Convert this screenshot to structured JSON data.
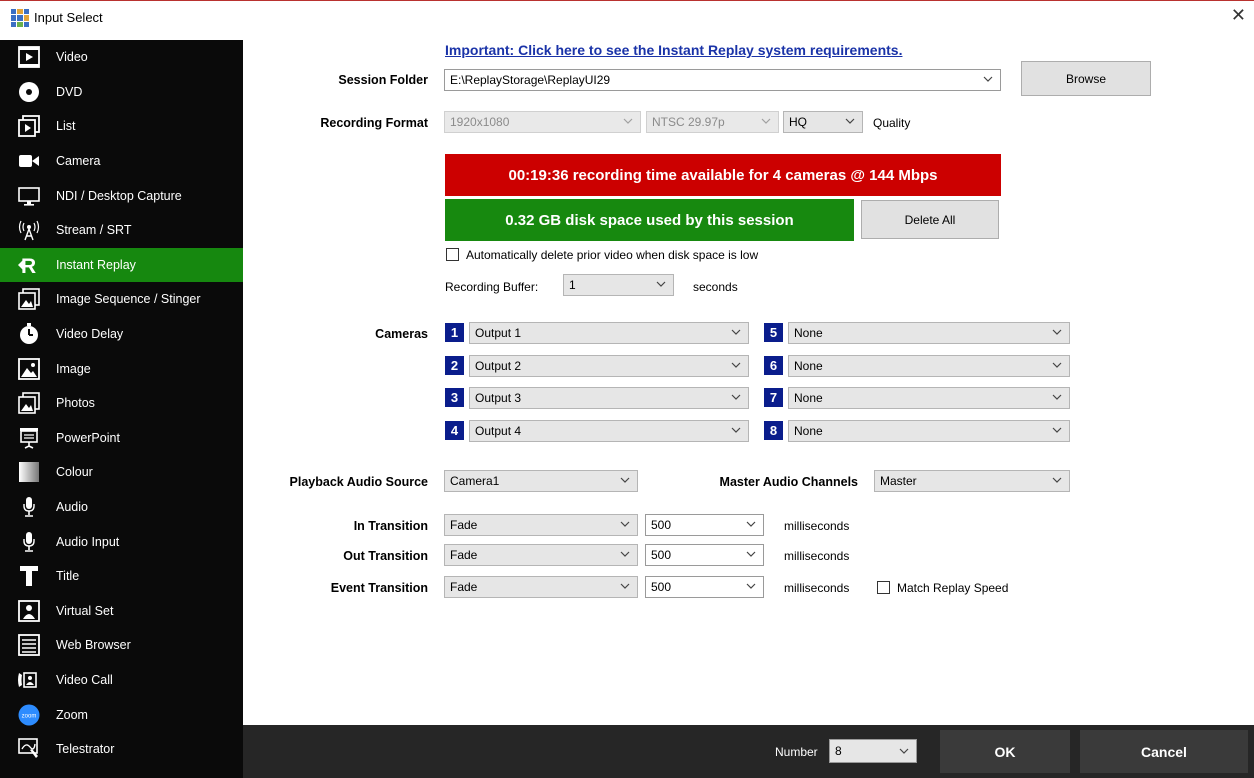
{
  "window": {
    "title": "Input Select",
    "close": "✕"
  },
  "sidebar": {
    "items": [
      {
        "label": "Video",
        "icon": "video-icon"
      },
      {
        "label": "DVD",
        "icon": "dvd-icon"
      },
      {
        "label": "List",
        "icon": "list-icon"
      },
      {
        "label": "Camera",
        "icon": "camera-icon"
      },
      {
        "label": "NDI / Desktop Capture",
        "icon": "monitor-icon"
      },
      {
        "label": "Stream / SRT",
        "icon": "antenna-icon"
      },
      {
        "label": "Instant Replay",
        "icon": "replay-icon",
        "active": true
      },
      {
        "label": "Image Sequence / Stinger",
        "icon": "image-sequence-icon"
      },
      {
        "label": "Video Delay",
        "icon": "timer-icon"
      },
      {
        "label": "Image",
        "icon": "image-icon"
      },
      {
        "label": "Photos",
        "icon": "photos-icon"
      },
      {
        "label": "PowerPoint",
        "icon": "presentation-icon"
      },
      {
        "label": "Colour",
        "icon": "colour-icon"
      },
      {
        "label": "Audio",
        "icon": "microphone-icon"
      },
      {
        "label": "Audio Input",
        "icon": "audio-input-icon"
      },
      {
        "label": "Title",
        "icon": "title-icon"
      },
      {
        "label": "Virtual Set",
        "icon": "virtual-set-icon"
      },
      {
        "label": "Web Browser",
        "icon": "web-browser-icon"
      },
      {
        "label": "Video Call",
        "icon": "video-call-icon"
      },
      {
        "label": "Zoom",
        "icon": "zoom-icon"
      },
      {
        "label": "Telestrator",
        "icon": "telestrator-icon"
      }
    ],
    "active_color": "#16880f"
  },
  "main": {
    "requirements_link": "Important: Click here to see the Instant Replay system requirements.",
    "session_folder": {
      "label": "Session Folder",
      "value": "E:\\ReplayStorage\\ReplayUI29",
      "browse": "Browse"
    },
    "recording_format": {
      "label": "Recording Format",
      "resolution": "1920x1080",
      "framerate": "NTSC 29.97p",
      "quality": "HQ",
      "quality_label": "Quality"
    },
    "recording_time_banner": "00:19:36 recording time available for 4 cameras @ 144 Mbps",
    "disk_space_banner": "0.32 GB disk space used by this session",
    "delete_all": "Delete All",
    "auto_delete_label": "Automatically delete prior video when disk space is low",
    "recording_buffer": {
      "label": "Recording Buffer:",
      "value": "1",
      "unit": "seconds"
    },
    "cameras": {
      "label": "Cameras",
      "slots": [
        {
          "num": "1",
          "value": "Output 1"
        },
        {
          "num": "2",
          "value": "Output 2"
        },
        {
          "num": "3",
          "value": "Output 3"
        },
        {
          "num": "4",
          "value": "Output 4"
        },
        {
          "num": "5",
          "value": "None"
        },
        {
          "num": "6",
          "value": "None"
        },
        {
          "num": "7",
          "value": "None"
        },
        {
          "num": "8",
          "value": "None"
        }
      ]
    },
    "playback_audio": {
      "label": "Playback Audio Source",
      "value": "Camera1"
    },
    "master_audio": {
      "label": "Master Audio Channels",
      "value": "Master"
    },
    "in_transition": {
      "label": "In Transition",
      "effect": "Fade",
      "duration": "500",
      "unit": "milliseconds"
    },
    "out_transition": {
      "label": "Out Transition",
      "effect": "Fade",
      "duration": "500",
      "unit": "milliseconds"
    },
    "event_transition": {
      "label": "Event Transition",
      "effect": "Fade",
      "duration": "500",
      "unit": "milliseconds",
      "match_label": "Match Replay Speed"
    }
  },
  "bottom": {
    "number_label": "Number",
    "number_value": "8",
    "ok": "OK",
    "cancel": "Cancel"
  }
}
